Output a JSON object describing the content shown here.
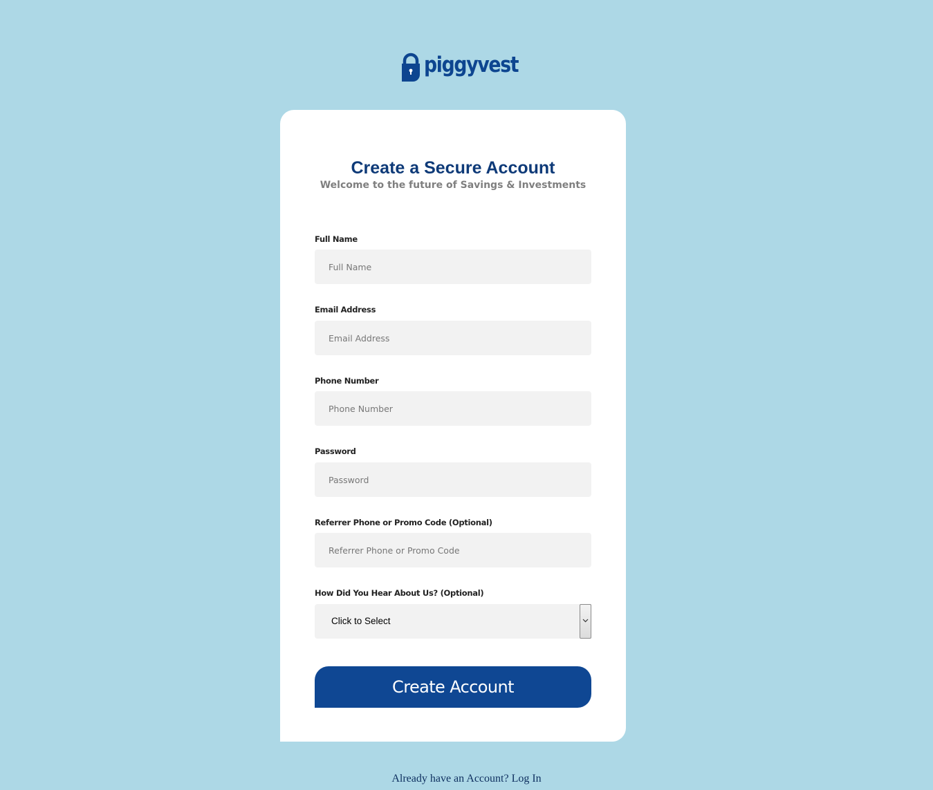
{
  "brand": {
    "name": "piggyvest",
    "icon": "padlock-icon",
    "color": "#0d4590"
  },
  "form": {
    "title": "Create a Secure Account",
    "subtitle": "Welcome to the future of Savings & Investments",
    "fields": [
      {
        "label": "Full Name",
        "placeholder": "Full Name",
        "value": ""
      },
      {
        "label": "Email Address",
        "placeholder": "Email Address",
        "value": ""
      },
      {
        "label": "Phone Number",
        "placeholder": "Phone Number",
        "value": ""
      },
      {
        "label": "Password",
        "placeholder": "Password",
        "value": ""
      },
      {
        "label": "Referrer Phone or Promo Code (Optional)",
        "placeholder": "Referrer Phone or Promo Code",
        "value": ""
      }
    ],
    "referral_source": {
      "label": "How Did You Hear About Us? (Optional)",
      "selected": "Click to Select",
      "icon": "chevron-down-icon"
    },
    "submit_label": "Create Account"
  },
  "footer": {
    "login_prompt": "Already have an Account? Log In"
  },
  "colors": {
    "page_background": "#add8e6",
    "card_background": "#ffffff",
    "primary_button": "#0f4793",
    "title": "#0e3a78",
    "input_background": "#f2f2f2"
  }
}
